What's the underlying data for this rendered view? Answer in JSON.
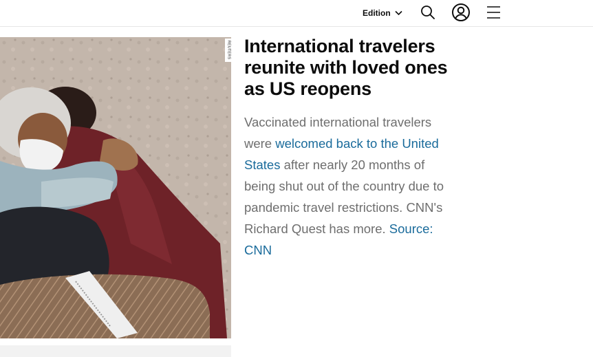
{
  "header": {
    "edition_label": "Edition",
    "icons": {
      "edition_chevron": "chevron-down-icon",
      "search": "search-icon",
      "account": "user-icon",
      "menu": "hamburger-menu-icon"
    }
  },
  "media": {
    "credit": "REUTERS"
  },
  "article": {
    "headline": "International travelers reunite with loved ones as US reopens",
    "desc_part1": "Vaccinated international travelers were ",
    "desc_link": "welcomed back to the United States",
    "desc_part2": " after nearly 20 months of being shut out of the country due to pandemic travel restrictions. CNN's Richard Quest has more. ",
    "source_link": "Source: CNN"
  },
  "colors": {
    "text": "#0c0c0c",
    "muted": "#6e6e6e",
    "link": "#1a6b9b",
    "divider": "#e6e6e6"
  }
}
